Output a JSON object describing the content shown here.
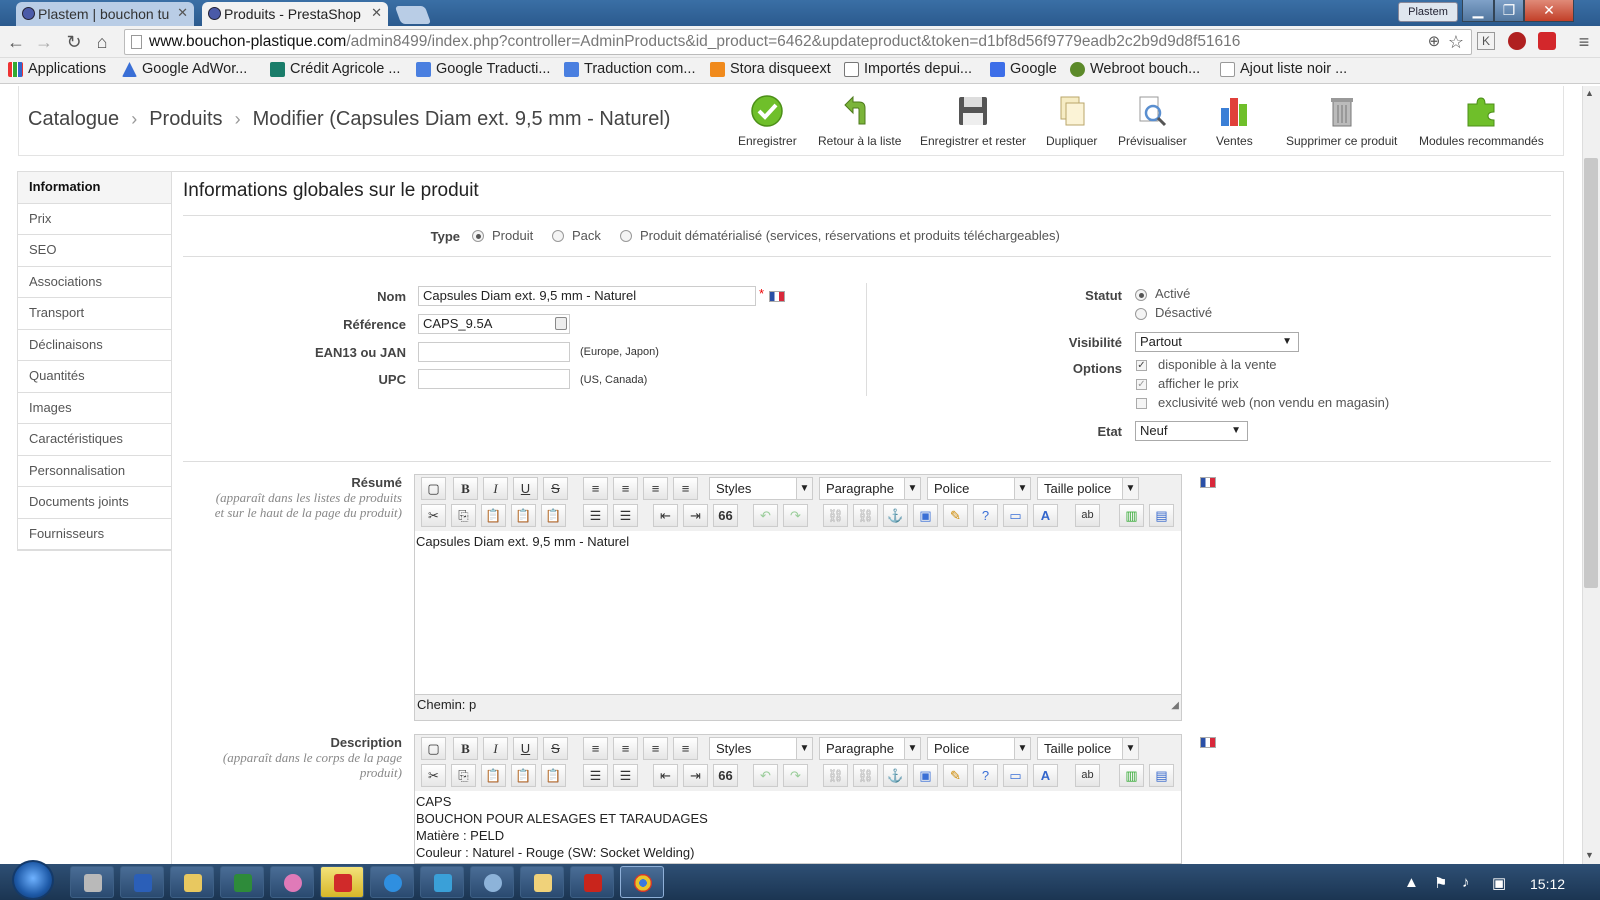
{
  "browser": {
    "tabs": [
      {
        "title": "Plastem | bouchon tu"
      },
      {
        "title": "Produits - PrestaShop"
      }
    ],
    "profile": "Plastem",
    "url_host": "www.bouchon-plastique.com",
    "url_rest": "/admin8499/index.php?controller=AdminProducts&id_product=6462&updateproduct&token=d1bf8d56f9779eadb2c2b9d9d8f51616",
    "bookmarks": [
      "Applications",
      "Google AdWor...",
      "Crédit Agricole ...",
      "Google Traducti...",
      "Traduction com...",
      "Stora disqueext",
      "Importés depui...",
      "Google",
      "Webroot bouch...",
      "Ajout liste noir ..."
    ]
  },
  "breadcrumb": {
    "a": "Catalogue",
    "b": "Produits",
    "c": "Modifier (Capsules Diam ext. 9,5 mm - Naturel)"
  },
  "toolbar": {
    "save": "Enregistrer",
    "back": "Retour à la liste",
    "save_stay": "Enregistrer et rester",
    "duplicate": "Dupliquer",
    "preview": "Prévisualiser",
    "sales": "Ventes",
    "delete": "Supprimer ce produit",
    "modules": "Modules recommandés"
  },
  "sidebar": {
    "items": [
      "Information",
      "Prix",
      "SEO",
      "Associations",
      "Transport",
      "Déclinaisons",
      "Quantités",
      "Images",
      "Caractéristiques",
      "Personnalisation",
      "Documents joints",
      "Fournisseurs"
    ]
  },
  "panel": {
    "title": "Informations globales sur le produit",
    "type_label": "Type",
    "type_options": [
      "Produit",
      "Pack",
      "Produit dématérialisé (services, réservations et produits téléchargeables)"
    ],
    "name_label": "Nom",
    "name_value": "Capsules Diam ext. 9,5 mm - Naturel",
    "required_mark": "*",
    "ref_label": "Référence",
    "ref_value": "CAPS_9.5A",
    "ean_label": "EAN13 ou JAN",
    "ean_hint": "(Europe, Japon)",
    "upc_label": "UPC",
    "upc_hint": "(US, Canada)",
    "status_label": "Statut",
    "status_on": "Activé",
    "status_off": "Désactivé",
    "visibility_label": "Visibilité",
    "visibility_value": "Partout",
    "options_label": "Options",
    "option_available": "disponible à la vente",
    "option_price": "afficher le prix",
    "option_web": "exclusivité web (non vendu en magasin)",
    "condition_label": "Etat",
    "condition_value": "Neuf"
  },
  "summary": {
    "label": "Résumé",
    "sub1": "(apparaît dans les listes de produits",
    "sub2": "et sur le haut de la page du produit)",
    "content": "Capsules Diam ext. 9,5 mm - Naturel",
    "path": "Chemin: p"
  },
  "description": {
    "label": "Description",
    "sub1": "(apparaît dans le corps de la page",
    "sub2": "produit)",
    "lines": [
      "CAPS",
      "BOUCHON POUR ALESAGES ET TARAUDAGES",
      "Matière : PELD",
      "Couleur : Naturel - Rouge (SW: Socket Welding)"
    ]
  },
  "editor": {
    "styles": "Styles",
    "paragraph": "Paragraphe",
    "font": "Police",
    "size": "Taille police",
    "bold": "B",
    "italic": "I",
    "underline": "U",
    "strike": "S",
    "quote": "66"
  },
  "taskbar": {
    "clock": "15:12"
  },
  "colors": {
    "accent_green": "#6fbf2a",
    "flag_blue": "#2a4fa6",
    "flag_red": "#d8283b"
  }
}
